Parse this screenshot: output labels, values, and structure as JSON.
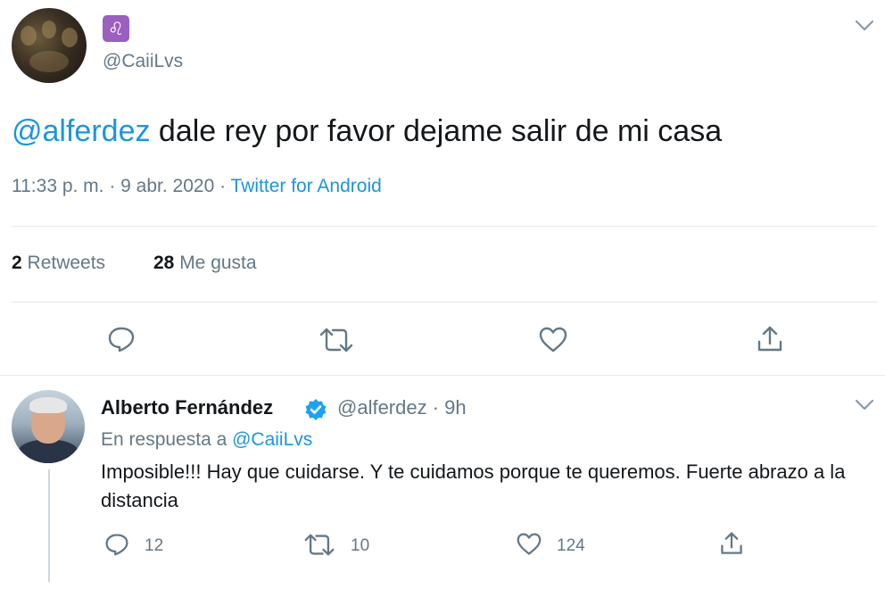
{
  "tweet": {
    "emoji": "♌",
    "handle": "@CaiiLvs",
    "mention": "@alferdez",
    "text": " dale rey por favor dejame salir de mi casa",
    "time_date": "11:33 p. m. · 9 abr. 2020 · ",
    "source": "Twitter for Android",
    "retweets_count": "2",
    "retweets_label": " Retweets",
    "likes_count": "28",
    "likes_label": " Me gusta"
  },
  "reply": {
    "author_name": "Alberto Fernández",
    "handle_time": "@alferdez · 9h",
    "reply_prefix": "En respuesta a ",
    "reply_to": "@CaiiLvs",
    "text": "Imposible!!! Hay que cuidarse. Y te cuidamos porque te queremos. Fuerte abrazo a la distancia",
    "reply_count": "12",
    "retweet_count": "10",
    "like_count": "124"
  },
  "colors": {
    "accent": "#1b95e0",
    "secondary_text": "#657786",
    "primary_text": "#14171a",
    "divider": "#e1e8ed"
  },
  "icons": [
    "chevron-down-icon",
    "reply-icon",
    "retweet-icon",
    "like-icon",
    "share-icon",
    "verified-badge-icon"
  ]
}
